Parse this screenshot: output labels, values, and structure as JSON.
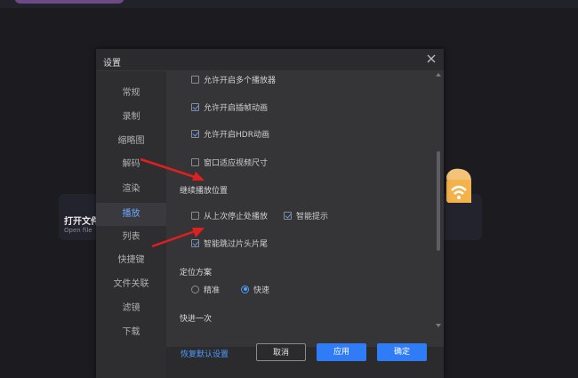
{
  "background": {
    "card_title": "打开文件",
    "card_subtitle": "Open file"
  },
  "dialog": {
    "title": "设置",
    "sidebar": [
      {
        "label": "常规"
      },
      {
        "label": "录制"
      },
      {
        "label": "缩略图"
      },
      {
        "label": "解码"
      },
      {
        "label": "渲染"
      },
      {
        "label": "播放",
        "active": true
      },
      {
        "label": "列表"
      },
      {
        "label": "快捷键"
      },
      {
        "label": "文件关联"
      },
      {
        "label": "滤镜"
      },
      {
        "label": "下载"
      }
    ],
    "options": {
      "multi_player": {
        "label": "允许开启多个播放器",
        "checked": false
      },
      "frame_interp": {
        "label": "允许开启插帧动画",
        "checked": true
      },
      "hdr": {
        "label": "允许开启HDR动画",
        "checked": true
      },
      "window_fit": {
        "label": "窗口适应视频尺寸",
        "checked": false
      },
      "resume_title": "继续播放位置",
      "resume_last": {
        "label": "从上次停止处播放",
        "checked": false
      },
      "smart_hint": {
        "label": "智能提示",
        "checked": true
      },
      "skip_intro": {
        "label": "智能跳过片头片尾",
        "checked": true
      },
      "seek_title": "定位方案",
      "seek_precise": {
        "label": "精准",
        "checked": false
      },
      "seek_fast": {
        "label": "快速",
        "checked": true
      },
      "forward_title": "快进一次"
    },
    "footer": {
      "restore": "恢复默认设置",
      "cancel": "取消",
      "apply": "应用",
      "ok": "确定"
    }
  },
  "colors": {
    "accent": "#2f7cf6",
    "arrow": "#e01f1f",
    "dialog_bg": "#2b2b2e",
    "content_bg": "#353538"
  }
}
